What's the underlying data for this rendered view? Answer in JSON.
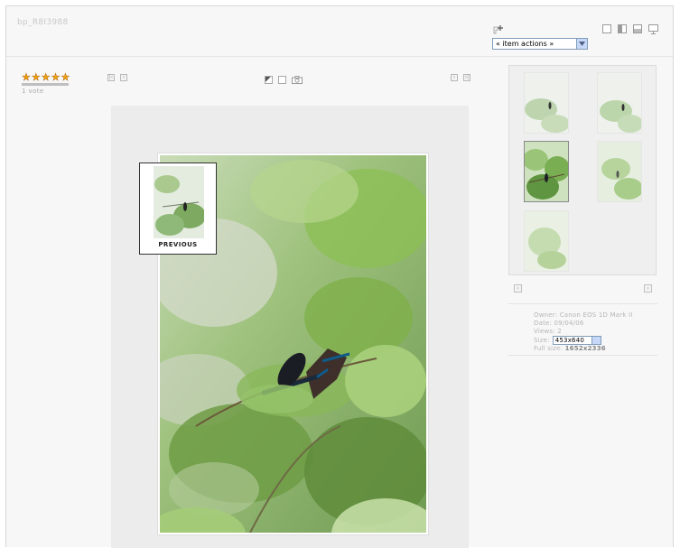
{
  "page": {
    "title": "bp_R8I3988"
  },
  "toolbar": {
    "item_actions": "« item actions »",
    "view_icons": [
      "single-view-icon",
      "grid-view-icon",
      "mosaic-view-icon",
      "slideshow-icon"
    ]
  },
  "rating": {
    "stars": 5,
    "votes": "1 vote"
  },
  "photo_tools": [
    "info-icon",
    "exif-icon",
    "camera-icon"
  ],
  "preview": {
    "label": "PREVIOUS"
  },
  "thumbnails": {
    "count": 5,
    "selected_index": 2
  },
  "meta": {
    "owner": "Owner: Canon EOS 1D Mark II",
    "date": "Date: 09/04/06",
    "views": "Views: 2",
    "size_label": "Size:",
    "size_value": "453x640",
    "fullsize_label": "Full size:",
    "fullsize_value": "1652x2336"
  },
  "colors": {
    "frame_bg": "#f7f7f7",
    "stage_bg": "#ececec",
    "star": "#f3a10e"
  }
}
